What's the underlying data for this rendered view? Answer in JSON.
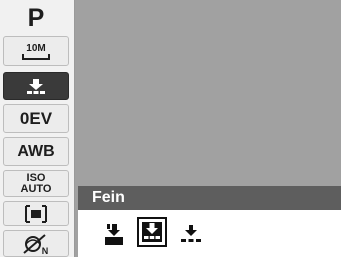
{
  "sidebar": {
    "mode": "P",
    "size": {
      "label": "10M",
      "icon": "image-size-icon"
    },
    "quality": {
      "icon": "quality-fine-icon",
      "selected": true
    },
    "ev": "0EV",
    "wb": "AWB",
    "iso": {
      "line1": "ISO",
      "line2": "AUTO"
    },
    "metering": {
      "icon": "metering-center-icon"
    },
    "scene": {
      "icon": "scene-mode-icon"
    }
  },
  "option_panel": {
    "title": "Fein",
    "options": [
      {
        "icon": "quality-superfine-icon",
        "selected": false
      },
      {
        "icon": "quality-fine-icon",
        "selected": true
      },
      {
        "icon": "quality-normal-icon",
        "selected": false
      }
    ]
  },
  "colors": {
    "sidebar_bg": "#f1f1f1",
    "preview_bg": "#a1a1a1",
    "selected_bg": "#3a3a3a",
    "title_bar_bg": "#5e5e5e"
  }
}
